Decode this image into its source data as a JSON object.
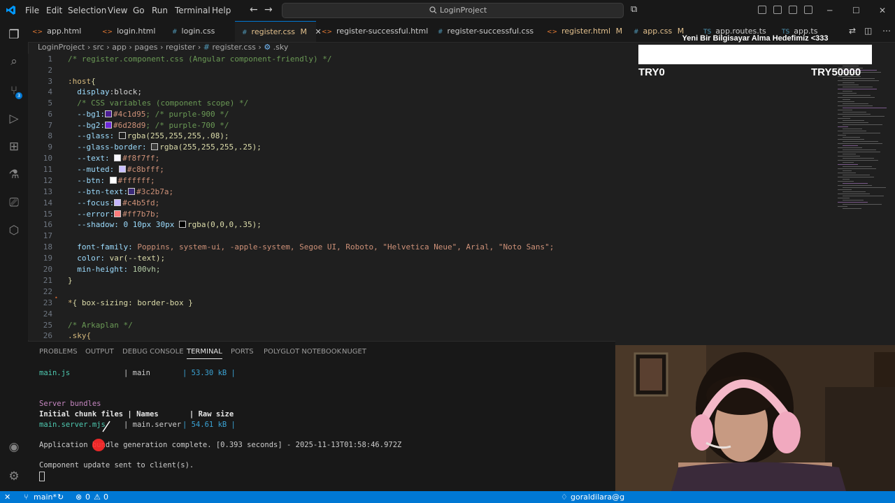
{
  "titlebar": {
    "menu": [
      "File",
      "Edit",
      "Selection",
      "View",
      "Go",
      "Run",
      "Terminal",
      "Help"
    ],
    "search_text": "LoginProject"
  },
  "tabs": [
    {
      "label": "app.html",
      "icon": "html-file-icon",
      "color": "#e37933"
    },
    {
      "label": "login.html",
      "icon": "html-file-icon",
      "color": "#e37933"
    },
    {
      "label": "login.css",
      "icon": "css-file-icon",
      "color": "#519aba"
    },
    {
      "label": "register.css",
      "badge": "M",
      "icon": "css-file-icon",
      "color": "#519aba",
      "active": true
    },
    {
      "label": "register-successful.html",
      "icon": "html-file-icon",
      "color": "#e37933"
    },
    {
      "label": "register-successful.css",
      "icon": "css-file-icon",
      "color": "#519aba"
    },
    {
      "label": "register.html",
      "badge": "M",
      "icon": "html-file-icon",
      "color": "#e37933"
    },
    {
      "label": "app.css",
      "badge": "M",
      "icon": "css-file-icon",
      "color": "#519aba"
    },
    {
      "label": "app.routes.ts",
      "icon": "ts-file-icon",
      "color": "#519aba"
    },
    {
      "label": "app.ts",
      "icon": "ts-file-icon",
      "color": "#519aba"
    }
  ],
  "breadcrumb": {
    "parts": [
      "LoginProject",
      "src",
      "app",
      "pages",
      "register",
      "register.css",
      ".sky"
    ]
  },
  "editor": {
    "lines": [
      "1",
      "2",
      "3",
      "4",
      "5",
      "6",
      "7",
      "8",
      "9",
      "10",
      "11",
      "12",
      "13",
      "14",
      "15",
      "16",
      "17",
      "18",
      "19",
      "20",
      "21",
      "22",
      "23",
      "24",
      "25",
      "26"
    ],
    "code": {
      "l1": "/* register.component.css (Angular component-friendly) */",
      "l3a": ":host",
      "l3b": "{",
      "l4a": "  display",
      "l4b": ":block;",
      "l5": "  /* CSS variables (component scope) */",
      "l6a": "  --bg1:",
      "l6b": "#4c1d95",
      "l6c": "; /* purple-900 */",
      "l7a": "  --bg2:",
      "l7b": "#6d28d9",
      "l7c": "; /* purple-700 */",
      "l8a": "  --glass: ",
      "l8b": "rgba(255,255,255,.08);",
      "l9a": "  --glass-border: ",
      "l9b": "rgba(255,255,255,.25);",
      "l10a": "  --text: ",
      "l10b": "#f8f7ff;",
      "l11a": "  --muted: ",
      "l11b": "#c8bfff;",
      "l12a": "  --btn: ",
      "l12b": "#ffffff;",
      "l13a": "  --btn-text:",
      "l13b": "#3c2b7a;",
      "l14a": "  --focus:",
      "l14b": "#c4b5fd;",
      "l15a": "  --error:",
      "l15b": "#ff7b7b;",
      "l16a": "  --shadow: 0 10px 30px ",
      "l16b": "rgba(0,0,0,.35);",
      "l18a": "  font-family: ",
      "l18b": "Poppins, system-ui, -apple-system, Segoe UI, Roboto, \"Helvetica Neue\", Arial, \"Noto Sans\";",
      "l19a": "  color: ",
      "l19b": "var(--text);",
      "l20a": "  min-height: ",
      "l20b": "100vh;",
      "l21": "}",
      "l23a": "*",
      "l23b": "{ box-sizing: border-box }",
      "l25": "/* Arkaplan */",
      "l26": ".sky{"
    },
    "swatches": {
      "bg1": "#4c1d95",
      "bg2": "#6d28d9",
      "glass": "#1f1f1f",
      "glass_border": "#3a3a3a",
      "text": "#f8f7ff",
      "muted": "#c8bfff",
      "btn": "#ffffff",
      "btn_text": "#3c2b7a",
      "focus": "#c4b5fd",
      "error": "#ff7b7b",
      "shadow": "#000000"
    }
  },
  "overlay": {
    "title": "Yeni Bir Bilgisayar Alma Hedefimiz <333",
    "left": "TRY0",
    "right": "TRY50000",
    "progress": 0
  },
  "panel": {
    "tabs": [
      "PROBLEMS",
      "OUTPUT",
      "DEBUG CONSOLE",
      "TERMINAL",
      "PORTS",
      "POLYGLOT NOTEBOOK",
      "NUGET"
    ],
    "active_tab": "TERMINAL",
    "terminal": {
      "row1_file": "main.js",
      "row1_name": "| main",
      "row1_size": "| 53.30 kB |",
      "section": "Server bundles",
      "header": "Initial chunk files | Names       | Raw size",
      "row2_file": "main.server.mjs",
      "row2_name": "| main.server",
      "row2_size": "| 54.61 kB |",
      "app_line": "Application bundle generation complete. [0.393 seconds] - 2025-11-13T01:58:46.972Z",
      "update_line": "Component update sent to client(s)."
    }
  },
  "statusbar": {
    "branch": "main*",
    "errors": "0",
    "warnings": "0",
    "user": "goraldilara@g"
  }
}
